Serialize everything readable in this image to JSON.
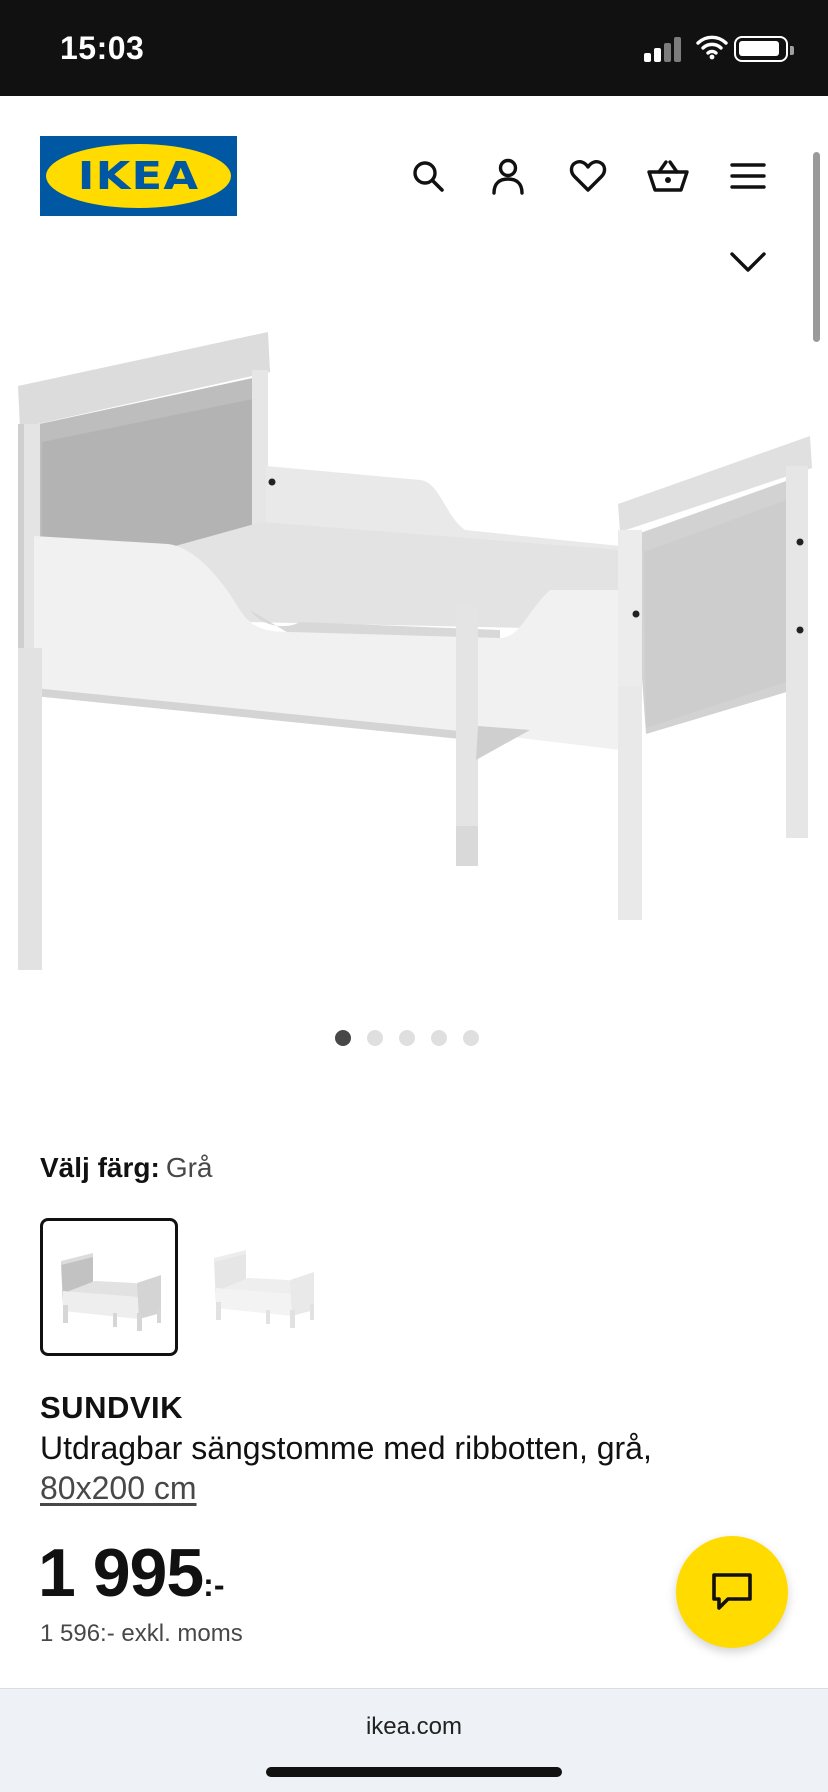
{
  "status_bar": {
    "time": "15:03",
    "icons": [
      "signal-icon",
      "wifi-icon",
      "battery-icon"
    ]
  },
  "header": {
    "logo_text": "IKEA",
    "icons": [
      "search-icon",
      "account-icon",
      "heart-icon",
      "cart-icon",
      "menu-icon"
    ]
  },
  "gallery": {
    "image": "bed-image",
    "image_count": 5,
    "active_index": 0
  },
  "color_select": {
    "label": "Välj färg:",
    "value": "Grå",
    "options": [
      "Grå",
      "Vit"
    ],
    "selected_index": 0
  },
  "product": {
    "name": "SUNDVIK",
    "description": "Utdragbar sängstomme med ribbotten, grå,",
    "size": "80x200 cm",
    "price": "1 995",
    "price_suffix": ":-",
    "price_excl_vat": "1 596:- exkl. moms"
  },
  "browser": {
    "url": "ikea.com"
  },
  "colors": {
    "ikea_blue": "#0058a3",
    "ikea_yellow": "#ffdb00",
    "status_bar_bg": "#111111",
    "inactive_dot": "#dfdfdf",
    "active_dot": "#484848"
  }
}
